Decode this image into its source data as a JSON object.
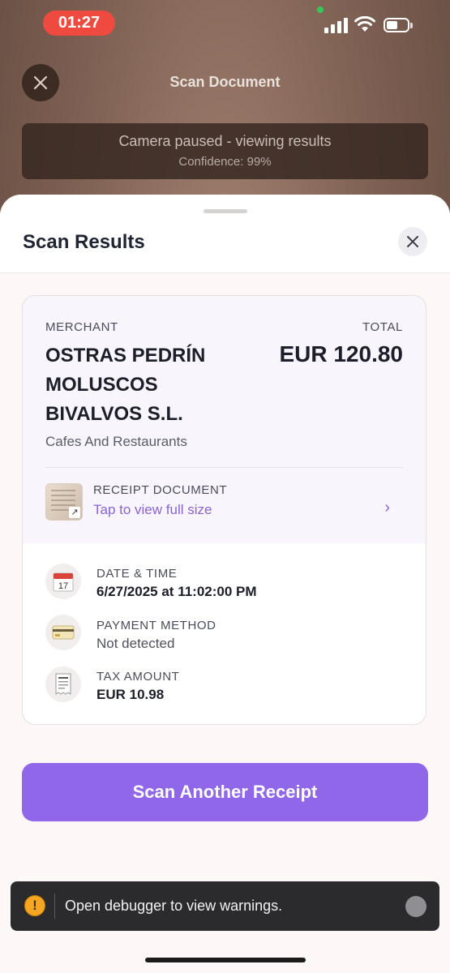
{
  "status_bar": {
    "time": "01:27"
  },
  "top_bar": {
    "title": "Scan Document"
  },
  "banner": {
    "line1": "Camera paused - viewing results",
    "line2": "Confidence: 99%"
  },
  "sheet": {
    "title": "Scan Results"
  },
  "card": {
    "merchant_label": "MERCHANT",
    "merchant_name": "OSTRAS PEDRÍN MOLUSCOS BIVALVOS S.L.",
    "category": "Cafes And Restaurants",
    "total_label": "TOTAL",
    "total_value": "EUR 120.80",
    "receipt_label": "RECEIPT DOCUMENT",
    "receipt_link": "Tap to view full size",
    "rows": [
      {
        "label": "DATE & TIME",
        "value": "6/27/2025 at 11:02:00 PM",
        "icon": "calendar-icon"
      },
      {
        "label": "PAYMENT METHOD",
        "value": "Not detected",
        "icon": "credit-card-icon"
      },
      {
        "label": "TAX AMOUNT",
        "value": "EUR 10.98",
        "icon": "receipt-icon"
      }
    ],
    "calendar_day": "17"
  },
  "actions": {
    "scan_another": "Scan Another Receipt"
  },
  "toast": {
    "icon": "!",
    "message": "Open debugger to view warnings."
  },
  "colors": {
    "accent": "#8f67e8",
    "link": "#8a63d2",
    "time_pill": "#ef4a3f"
  }
}
